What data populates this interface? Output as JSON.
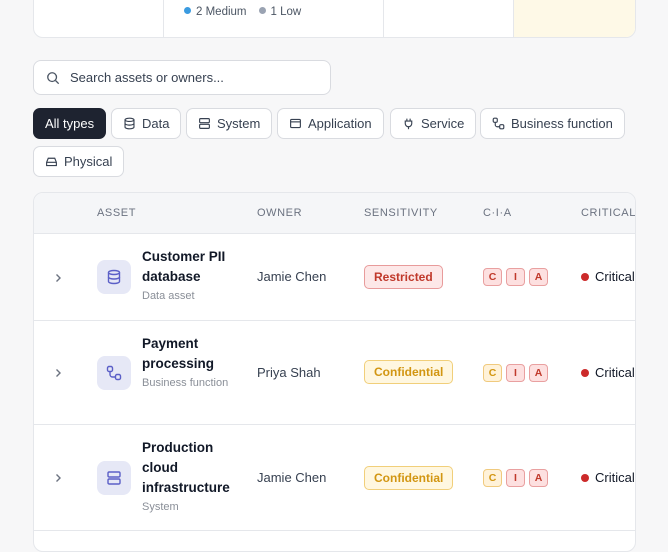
{
  "summary": {
    "legend": [
      {
        "label": "2 Medium",
        "color": "#3b9be0"
      },
      {
        "label": "1 Low",
        "color": "#9aa3b2"
      }
    ]
  },
  "search": {
    "placeholder": "Search assets or owners..."
  },
  "filters": [
    {
      "label": "All types",
      "icon": "none",
      "active": true
    },
    {
      "label": "Data",
      "icon": "database-icon"
    },
    {
      "label": "System",
      "icon": "server-icon"
    },
    {
      "label": "Application",
      "icon": "window-icon"
    },
    {
      "label": "Service",
      "icon": "plug-icon"
    },
    {
      "label": "Business function",
      "icon": "workflow-icon"
    },
    {
      "label": "Physical",
      "icon": "hard-drive-icon"
    }
  ],
  "table": {
    "headers": {
      "asset": "ASSET",
      "owner": "OWNER",
      "sensitivity": "SENSITIVITY",
      "cia": "C·I·A",
      "criticality": "CRITICALITY"
    },
    "rows": [
      {
        "name": "Customer PII database",
        "type": "Data asset",
        "icon": "database-icon",
        "owner": "Jamie Chen",
        "sensitivity": "Restricted",
        "cia": [
          "C",
          "I",
          "A"
        ],
        "criticality": "Critical"
      },
      {
        "name": "Payment processing",
        "type": "Business function",
        "icon": "workflow-icon",
        "owner": "Priya Shah",
        "sensitivity": "Confidential",
        "cia": [
          "C",
          "I",
          "A"
        ],
        "criticality": "Critical"
      },
      {
        "name": "Production cloud infrastructure",
        "type": "System",
        "icon": "server-icon",
        "owner": "Jamie Chen",
        "sensitivity": "Confidential",
        "cia": [
          "C",
          "I",
          "A"
        ],
        "criticality": "Critical"
      }
    ]
  },
  "colors": {
    "accent_dark": "#1e2330",
    "icon_tint": "#5b5fc7",
    "critical": "#cc2a2a"
  }
}
